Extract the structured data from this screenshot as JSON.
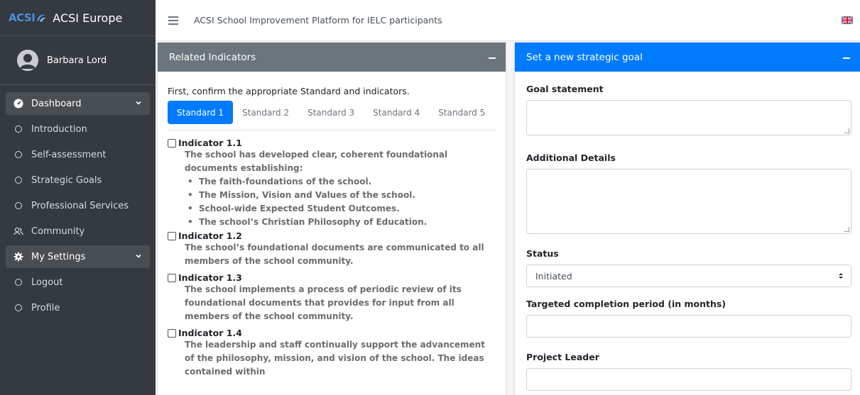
{
  "brand": {
    "logo_text": "ACSI",
    "name": "ACSI Europe"
  },
  "user": {
    "name": "Barbara Lord"
  },
  "sidebar": {
    "items": [
      {
        "label": "Dashboard",
        "icon": "tachometer-icon",
        "active": true,
        "expandable": true
      },
      {
        "label": "Introduction",
        "icon": "circle-icon"
      },
      {
        "label": "Self-assessment",
        "icon": "circle-icon"
      },
      {
        "label": "Strategic Goals",
        "icon": "circle-icon"
      },
      {
        "label": "Professional Services",
        "icon": "circle-icon"
      },
      {
        "label": "Community",
        "icon": "users-icon"
      },
      {
        "label": "My Settings",
        "icon": "gear-icon",
        "active": true,
        "expandable": true
      },
      {
        "label": "Logout",
        "icon": "circle-icon"
      },
      {
        "label": "Profile",
        "icon": "circle-icon"
      }
    ]
  },
  "topbar": {
    "title": "ACSI School Improvement Platform for IELC participants",
    "flag_icon": "uk-flag-icon"
  },
  "related": {
    "title": "Related Indicators",
    "intro": "First, confirm the appropriate Standard and indicators.",
    "tabs": [
      "Standard 1",
      "Standard 2",
      "Standard 3",
      "Standard 4",
      "Standard 5"
    ],
    "active_tab": 0,
    "indicators": [
      {
        "label": "Indicator 1.1",
        "text": "The school has developed clear, coherent foundational documents establishing:",
        "bullets": [
          "The faith-foundations of the school.",
          "The Mission, Vision and Values of the school.",
          "School-wide Expected Student Outcomes.",
          "The school’s Christian Philosophy of Education."
        ]
      },
      {
        "label": "Indicator 1.2",
        "text": "The school’s foundational documents are communicated to all members of the school community."
      },
      {
        "label": "Indicator 1.3",
        "text": "The school implements a process of periodic review of its foundational documents that provides for input from all members of the school community."
      },
      {
        "label": "Indicator 1.4",
        "text": "The leadership and staff continually support the advancement of the philosophy, mission, and vision of the school. The ideas contained within"
      }
    ]
  },
  "goal_form": {
    "title": "Set a new strategic goal",
    "goal_statement_label": "Goal statement",
    "goal_statement_value": "",
    "additional_details_label": "Additional Details",
    "additional_details_value": "",
    "status_label": "Status",
    "status_value": "Initiated",
    "completion_label": "Targeted completion period (in months)",
    "completion_value": "",
    "leader_label": "Project Leader",
    "leader_value": ""
  },
  "colors": {
    "primary": "#007bff",
    "sidebar": "#343a40",
    "grey_header": "#6c757d"
  }
}
